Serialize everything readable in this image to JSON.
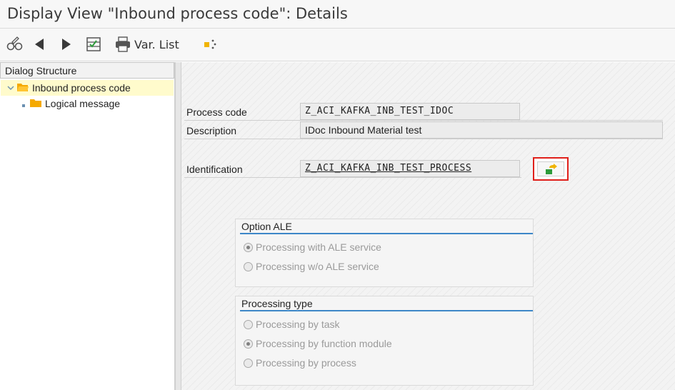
{
  "window": {
    "title": "Display View \"Inbound process code\": Details"
  },
  "toolbar": {
    "var_list_label": "Var. List"
  },
  "dialog_structure": {
    "header": "Dialog Structure",
    "items": [
      {
        "label": "Inbound process code",
        "selected": true
      },
      {
        "label": "Logical message",
        "selected": false
      }
    ]
  },
  "details": {
    "process_code_label": "Process code",
    "process_code_value": "Z_ACI_KAFKA_INB_TEST_IDOC",
    "description_label": "Description",
    "description_value": "IDoc Inbound Material test",
    "identification_label": "Identification",
    "identification_value": "Z_ACI_KAFKA_INB_TEST_PROCESS"
  },
  "option_ale": {
    "title": "Option ALE",
    "options": [
      {
        "label": "Processing with ALE service",
        "selected": true
      },
      {
        "label": "Processing w/o ALE service",
        "selected": false
      }
    ]
  },
  "processing_type": {
    "title": "Processing type",
    "options": [
      {
        "label": "Processing by task",
        "selected": false
      },
      {
        "label": "Processing by function module",
        "selected": true
      },
      {
        "label": "Processing by process",
        "selected": false
      }
    ]
  },
  "colors": {
    "accent": "#3d87c8",
    "highlight": "#e0201b",
    "folder": "#f5a900"
  }
}
